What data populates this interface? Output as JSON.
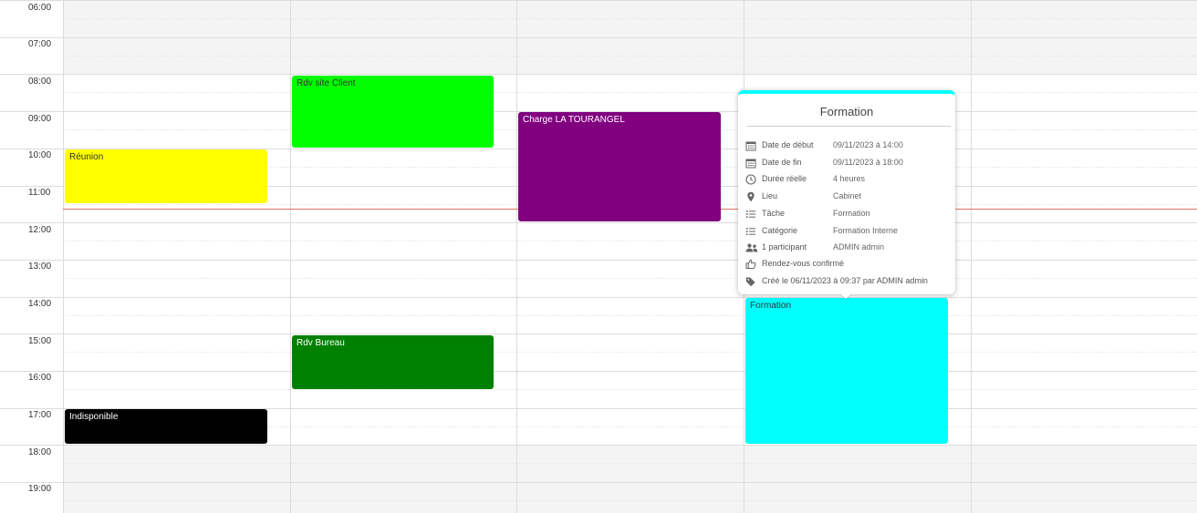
{
  "time_slots": [
    "06:00",
    "07:00",
    "08:00",
    "09:00",
    "10:00",
    "11:00",
    "12:00",
    "13:00",
    "14:00",
    "15:00",
    "16:00",
    "17:00",
    "18:00",
    "19:00"
  ],
  "events": {
    "reunion": "Réunion",
    "rdv_client": "Rdv site Client",
    "charge": "Charge LA TOURANGEL",
    "rdv_bureau": "Rdv Bureau",
    "indisponible": "Indisponible",
    "formation": "Formation"
  },
  "event_colors": {
    "reunion": "#ffff00",
    "rdv_client": "#00ff00",
    "charge": "#800080",
    "rdv_bureau": "#008000",
    "indisponible": "#000000",
    "formation": "#00ffff"
  },
  "popup": {
    "title": "Formation",
    "rows": [
      {
        "icon": "calendar-icon",
        "label": "Date de début",
        "value": "09/11/2023 à 14:00"
      },
      {
        "icon": "calendar-icon",
        "label": "Date de fin",
        "value": "09/11/2023 à 18:00"
      },
      {
        "icon": "clock-icon",
        "label": "Durée réelle",
        "value": "4 heures"
      },
      {
        "icon": "map-pin-icon",
        "label": "Lieu",
        "value": "Cabinet"
      },
      {
        "icon": "list-icon",
        "label": "Tâche",
        "value": "Formation"
      },
      {
        "icon": "list-icon",
        "label": "Catégorie",
        "value": "Formation Interne"
      },
      {
        "icon": "users-icon",
        "label": "1 participant",
        "value": "ADMIN admin"
      },
      {
        "icon": "thumbs-up-icon",
        "label": "Rendez-vous confirmé",
        "value": ""
      },
      {
        "icon": "tags-icon",
        "label": "Créé le 06/11/2023 à 09:37 par ADMIN admin",
        "value": ""
      }
    ]
  },
  "colors": {
    "now_line": "#e0736b",
    "grid_line": "#dcdcdc",
    "popup_accent": "#00ffff"
  }
}
